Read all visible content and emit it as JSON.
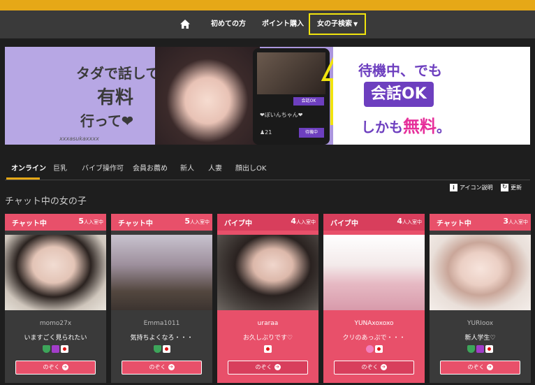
{
  "nav": {
    "items": [
      "初めての方",
      "ポイント購入"
    ],
    "search_label": "女の子検索"
  },
  "banner": {
    "tada": "タダで話して",
    "yuryo": "有料",
    "itte": "行って❤",
    "sign": "xxxasukaxxxx",
    "phone_badge": "会話OK",
    "phone_name": "❤ぼいんちゃん❤",
    "phone_count": "♟21",
    "phone_stat": "待機中",
    "right_a": "待機中、でも",
    "right_b": "会話OK",
    "right_c_pre": "しかも",
    "right_c_hl": "無料",
    "right_c_post": "。"
  },
  "tabs": [
    "オンライン",
    "巨乳",
    "バイブ操作可",
    "会員お薦め",
    "新人",
    "人妻",
    "顔出しOK"
  ],
  "section": {
    "title": "チャット中の女の子",
    "legend": "アイコン説明",
    "refresh": "更新"
  },
  "cards": [
    {
      "status": "チャット中",
      "count": "5",
      "suffix": "人入室中",
      "name": "momo27x",
      "message": "いますごく見られたい",
      "button": "のぞく"
    },
    {
      "status": "チャット中",
      "count": "5",
      "suffix": "人入室中",
      "name": "Emma1011",
      "message": "気持ちよくなろ・・・",
      "button": "のぞく"
    },
    {
      "status": "バイブ中",
      "count": "4",
      "suffix": "人入室中",
      "name": "uraraa",
      "message": "お久しぶりです♡",
      "button": "のぞく"
    },
    {
      "status": "バイブ中",
      "count": "4",
      "suffix": "人入室中",
      "name": "YUNAxoxoxo",
      "message": "クリのあっぷで・・・",
      "button": "のぞく"
    },
    {
      "status": "チャット中",
      "count": "3",
      "suffix": "人入室中",
      "name": "YURIoox",
      "message": "新人学生♡",
      "button": "のぞく"
    }
  ]
}
